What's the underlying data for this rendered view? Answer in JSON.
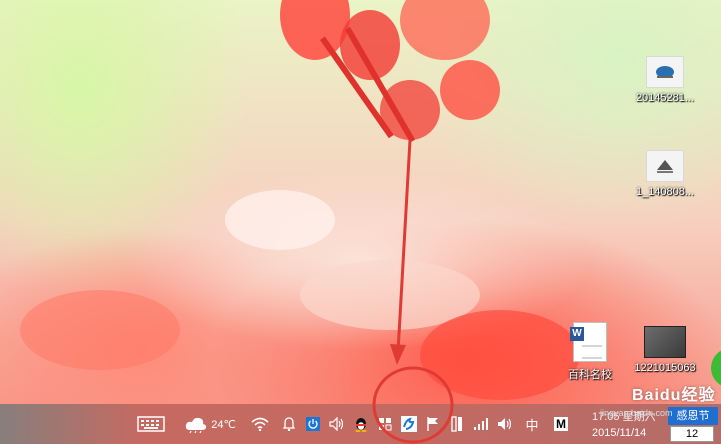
{
  "desktop": {
    "icons": [
      {
        "label": "20145281...",
        "kind": "image-file"
      },
      {
        "label": "1_140808...",
        "kind": "image-file"
      },
      {
        "label": "百科名校",
        "kind": "word-document"
      },
      {
        "label": "1221015063",
        "kind": "book-image"
      }
    ],
    "watermark": "Baidu经验",
    "watermark_url": "jingyan.baidu.com"
  },
  "taskbar": {
    "weather": {
      "icon": "cloud-icon",
      "temperature": "24℃"
    },
    "tray_icons": [
      "keyboard-icon",
      "cloud-icon",
      "wifi-icon",
      "bell-icon",
      "power-icon",
      "volume-icon",
      "qq-penguin-icon",
      "flag-window-icon",
      "highlighted-app-icon",
      "flag-icon",
      "device-icon",
      "signal-icon",
      "speaker-icon",
      "ime-icon",
      "m-icon"
    ],
    "ime_label": "中",
    "m_label": "M",
    "clock": {
      "time": "17:05 星期六",
      "date": "2015/11/14"
    },
    "holiday": {
      "label": "感恩节",
      "day": "12"
    }
  },
  "colors": {
    "annotation": "#e03a34",
    "holiday_blue": "#1e6fd0",
    "tray_highlight": "#1a78d4"
  }
}
